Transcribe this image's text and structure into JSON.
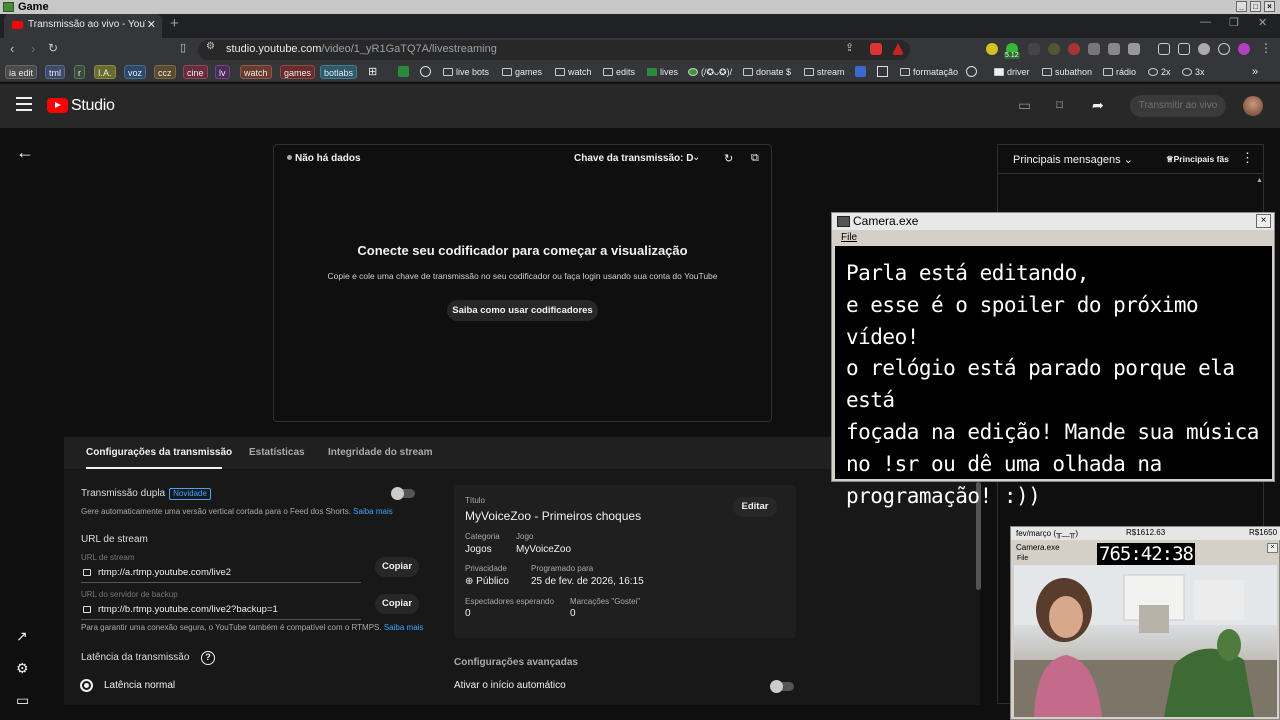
{
  "os": {
    "title": "Game"
  },
  "browser": {
    "tab_title": "Transmissão ao vivo - YouTube S",
    "url_domain": "studio.youtube.com",
    "url_path": "/video/1_yR1GaTQ7A/livestreaming",
    "bookmarks_tags": [
      "ia edit",
      "tml",
      "r",
      "I.A.",
      "voz",
      "ccz",
      "cine",
      "lv",
      "watch",
      "games",
      "botlabs"
    ],
    "bookmarks_items": [
      "live bots",
      "games",
      "watch",
      "edits",
      "lives",
      "(/✪ᴗ✪)/",
      "donate $",
      "stream",
      "formatação",
      "driver",
      "subathon",
      "rádio",
      "2x",
      "3x"
    ],
    "ext_badge": "5.12"
  },
  "studio": {
    "logo": "Studio",
    "go_live": "Transmitir ao vivo"
  },
  "preview": {
    "status": "Não há dados",
    "stream_key": "Chave da transmissão: Defa",
    "title": "Conecte seu codificador para começar a visualização",
    "subtitle": "Copie e cole uma chave de transmissão no seu codificador ou faça login usando sua conta do YouTube",
    "button": "Saiba como usar codificadores"
  },
  "settings": {
    "tabs": [
      "Configurações da transmissão",
      "Estatísticas",
      "Integridade do stream"
    ],
    "dual_label": "Transmissão dupla",
    "dual_badge": "Novidade",
    "dual_desc": "Gere automaticamente uma versão vertical cortada para o Feed dos Shorts.",
    "learn_more": "Saiba mais",
    "url_heading": "URL de stream",
    "url_label": "URL de stream",
    "url_value": "rtmp://a.rtmp.youtube.com/live2",
    "backup_label": "URL do servidor de backup",
    "backup_value": "rtmp://b.rtmp.youtube.com/live2?backup=1",
    "copy": "Copiar",
    "secure_note": "Para garantir uma conexão segura, o YouTube também é compatível com o RTMPS.",
    "latency_heading": "Latência da transmissão",
    "latency_option": "Latência normal",
    "advanced": "Configurações avançadas",
    "autostart": "Ativar o início automático"
  },
  "info": {
    "title_label": "Título",
    "title": "MyVoiceZoo - Primeiros choques",
    "edit": "Editar",
    "category_label": "Categoria",
    "category": "Jogos",
    "game_label": "Jogo",
    "game": "MyVoiceZoo",
    "privacy_label": "Privacidade",
    "privacy": "Público",
    "scheduled_label": "Programado para",
    "scheduled": "25 de fev. de 2026, 16:15",
    "waiting_label": "Espectadores esperando",
    "waiting": "0",
    "likes_label": "Marcações \"Gostei\"",
    "likes": "0"
  },
  "chat": {
    "title": "Principais mensagens",
    "fans": "Principais fãs"
  },
  "camera1": {
    "title": "Camera.exe",
    "menu": "File",
    "message": "Parla está editando,\ne esse é o spoiler do próximo vídeo!\no relógio está parado porque ela está\nfoçada na edição! Mande sua música\nno !sr ou dê uma olhada na\nprogramação!  :))"
  },
  "camera2": {
    "top_left": "fev/março (╥﹏╥)",
    "top_mid": "R$1612.63",
    "top_right": "R$1650",
    "title": "Camera.exe",
    "menu": "File",
    "clock": "765:42:38"
  }
}
